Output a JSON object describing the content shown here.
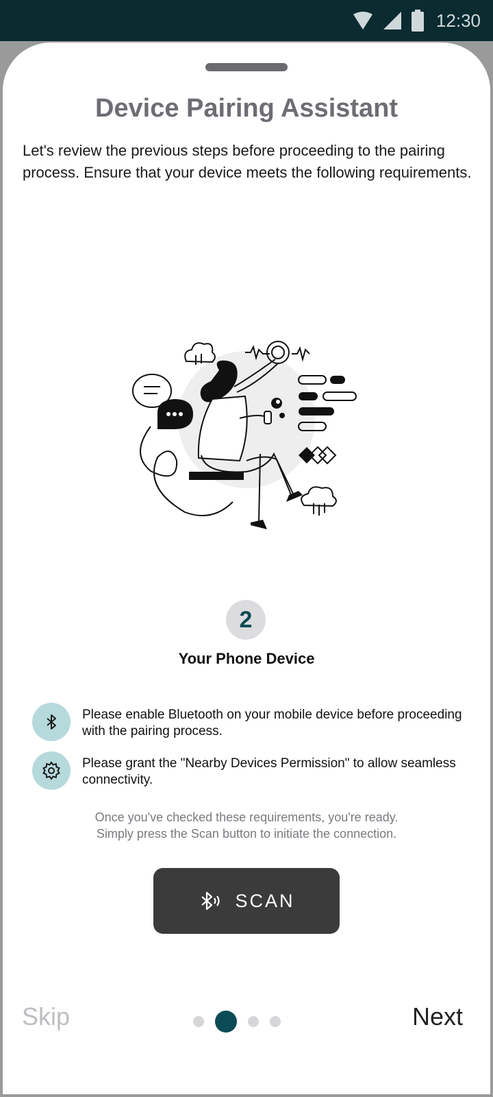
{
  "status_bar": {
    "time": "12:30",
    "icons": [
      "wifi-icon",
      "cellular-signal-icon",
      "battery-icon"
    ]
  },
  "sheet": {
    "title": "Device Pairing Assistant",
    "intro": "Let's review the previous steps before proceeding to the pairing process. Ensure that your device meets the following requirements."
  },
  "step": {
    "number": "2",
    "title": "Your Phone Device"
  },
  "requirements": [
    {
      "icon": "bluetooth-icon",
      "text": "Please enable Bluetooth on your mobile device before proceeding with the pairing process."
    },
    {
      "icon": "gear-icon",
      "text": "Please grant the \"Nearby Devices Permission\" to allow seamless connectivity."
    }
  ],
  "note": {
    "line1": "Once you've checked these requirements, you're ready.",
    "line2": "Simply press the Scan button to initiate the connection."
  },
  "scan_button": {
    "label": "SCAN",
    "icon": "bluetooth-searching-icon"
  },
  "footer": {
    "skip_label": "Skip",
    "next_label": "Next",
    "page_count": 4,
    "current_page": 2
  },
  "colors": {
    "status_bar": "#0a2b30",
    "accent": "#0b4b56",
    "icon_circle": "#b6d9dc",
    "button": "#3b3b3b"
  }
}
